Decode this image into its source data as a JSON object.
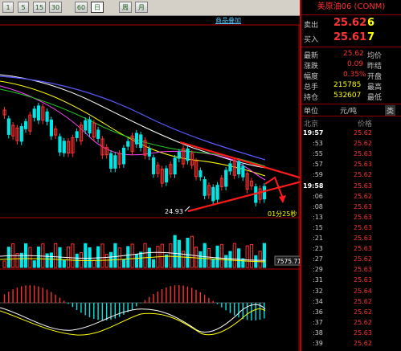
{
  "toolbar": {
    "buttons": [
      "1",
      "5",
      "15",
      "30",
      "60",
      "日",
      "周",
      "月"
    ],
    "active_index": 5
  },
  "chart": {
    "link_label": "商品叠加",
    "low_label": "24.93",
    "countdown_label": "01分25秒",
    "volume_label": "7575.71"
  },
  "panel": {
    "title": "美原油06 (CONM)",
    "sell": {
      "label": "卖出",
      "price": "25.62",
      "qty": "6"
    },
    "buy": {
      "label": "买入",
      "price": "25.61",
      "qty": "7"
    },
    "stats_left": [
      {
        "label": "最新",
        "value": "25.62"
      },
      {
        "label": "涨跌",
        "value": "0.09"
      },
      {
        "label": "幅度",
        "value": "0.35%"
      },
      {
        "label": "总手",
        "value": "215785"
      },
      {
        "label": "持仓",
        "value": "532607"
      }
    ],
    "stats_right": [
      "均价",
      "昨结",
      "开盘",
      "最高",
      "最低"
    ],
    "unit_label": "单位",
    "unit_value": "元/吨",
    "unit_tab": "类",
    "col_time": "北京",
    "col_price": "价格",
    "ticks": [
      {
        "t": "19:57",
        "p": "25.62",
        "bold": true
      },
      {
        "t": ":53",
        "p": "25.62"
      },
      {
        "t": ":55",
        "p": "25.63"
      },
      {
        "t": ":57",
        "p": "25.63"
      },
      {
        "t": ":59",
        "p": "25.62"
      },
      {
        "t": "19:58",
        "p": "25.63",
        "bold": true
      },
      {
        "t": ":06",
        "p": "25.62"
      },
      {
        "t": ":08",
        "p": "25.63"
      },
      {
        "t": ":13",
        "p": "25.63"
      },
      {
        "t": ":15",
        "p": "25.63"
      },
      {
        "t": ":21",
        "p": "25.63"
      },
      {
        "t": ":23",
        "p": "25.63"
      },
      {
        "t": ":27",
        "p": "25.62"
      },
      {
        "t": ":29",
        "p": "25.63"
      },
      {
        "t": ":31",
        "p": "25.63"
      },
      {
        "t": ":32",
        "p": "25.64"
      },
      {
        "t": ":34",
        "p": "25.62"
      },
      {
        "t": ":36",
        "p": "25.62"
      },
      {
        "t": ":37",
        "p": "25.62"
      },
      {
        "t": ":38",
        "p": "25.63"
      },
      {
        "t": ":39",
        "p": "25.62"
      }
    ]
  }
}
